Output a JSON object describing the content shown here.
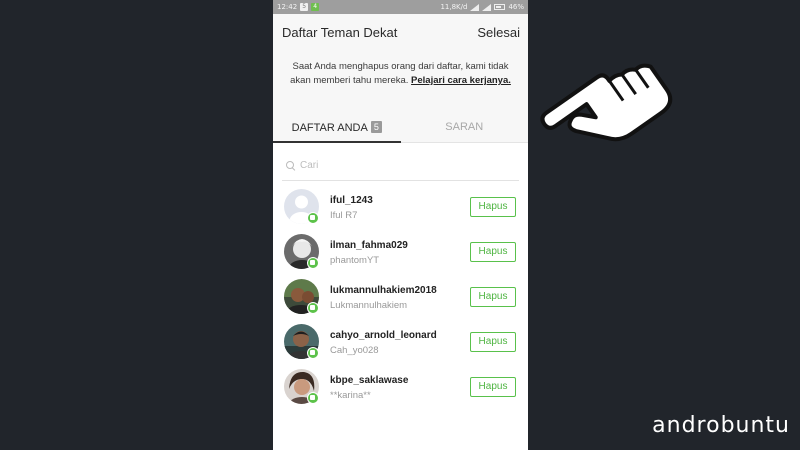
{
  "statusbar": {
    "time": "12:42",
    "speed": "11,8K/d",
    "battery": "46%",
    "badges": [
      "5",
      "4"
    ]
  },
  "header": {
    "title": "Daftar Teman Dekat",
    "done_label": "Selesai"
  },
  "info": {
    "text": "Saat Anda menghapus orang dari daftar, kami tidak akan memberi tahu mereka.",
    "link": "Pelajari cara kerjanya."
  },
  "tabs": [
    {
      "label": "DAFTAR ANDA",
      "count": "5",
      "active": true
    },
    {
      "label": "SARAN",
      "active": false
    }
  ],
  "search": {
    "placeholder": "Cari",
    "value": ""
  },
  "friends": [
    {
      "username": "iful_1243",
      "display_name": "Iful R7",
      "button": "Hapus",
      "avatar": "default-avatar"
    },
    {
      "username": "ilman_fahma029",
      "display_name": "phantomYT",
      "button": "Hapus",
      "avatar": "photo-avatar"
    },
    {
      "username": "lukmannulhakiem2018",
      "display_name": "Lukmannulhakiem",
      "button": "Hapus",
      "avatar": "photo-avatar"
    },
    {
      "username": "cahyo_arnold_leonard",
      "display_name": "Cah_yo028",
      "button": "Hapus",
      "avatar": "photo-avatar"
    },
    {
      "username": "kbpe_saklawase",
      "display_name": "**karina**",
      "button": "Hapus",
      "avatar": "photo-avatar"
    }
  ],
  "overlay": {
    "pointer_icon": "pointing-hand-icon",
    "brand": "androbuntu"
  },
  "colors": {
    "accent_green": "#59c14b",
    "background": "#21252b",
    "panel": "#f7f7f7"
  }
}
